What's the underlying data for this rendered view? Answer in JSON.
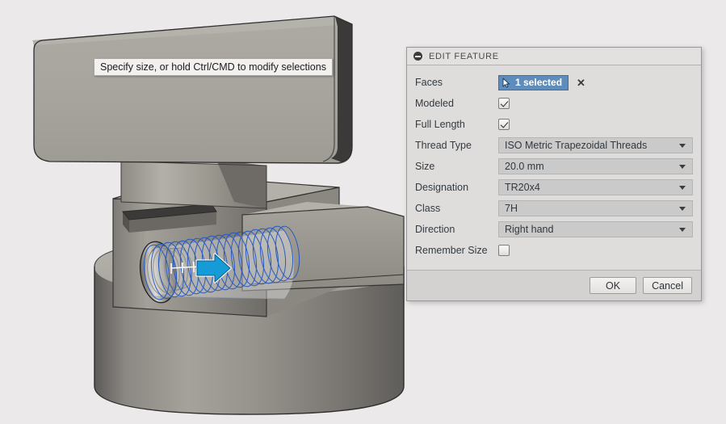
{
  "viewport": {
    "tooltip": "Specify size, or hold Ctrl/CMD to modify selections",
    "manipulator": "drag-arrow-manipulator"
  },
  "dialog": {
    "title": "EDIT FEATURE",
    "collapse_icon": "collapse-minus-icon",
    "rows": [
      {
        "label": "Faces",
        "type": "selection",
        "value": "1 selected",
        "clear": "✕",
        "icon": "selection-cursor-icon"
      },
      {
        "label": "Modeled",
        "type": "checkbox",
        "checked": true
      },
      {
        "label": "Full Length",
        "type": "checkbox",
        "checked": true
      },
      {
        "label": "Thread Type",
        "type": "combo",
        "value": "ISO Metric Trapezoidal Threads"
      },
      {
        "label": "Size",
        "type": "combo",
        "value": "20.0 mm"
      },
      {
        "label": "Designation",
        "type": "combo",
        "value": "TR20x4"
      },
      {
        "label": "Class",
        "type": "combo",
        "value": "7H"
      },
      {
        "label": "Direction",
        "type": "combo",
        "value": "Right hand"
      },
      {
        "label": "Remember Size",
        "type": "checkbox",
        "checked": false
      }
    ],
    "footer": {
      "ok": "OK",
      "cancel": "Cancel"
    }
  },
  "colors": {
    "selection_blue": "#5f8dbb",
    "thread_preview_blue": "#2255bb",
    "manipulator_blue": "#1a9ad4",
    "dialog_bg": "#dedddc",
    "viewport_bg": "#ebe9e9",
    "metal_light": "#a8a59e",
    "metal_mid": "#8d8a84",
    "metal_dark": "#3a3a3a"
  }
}
